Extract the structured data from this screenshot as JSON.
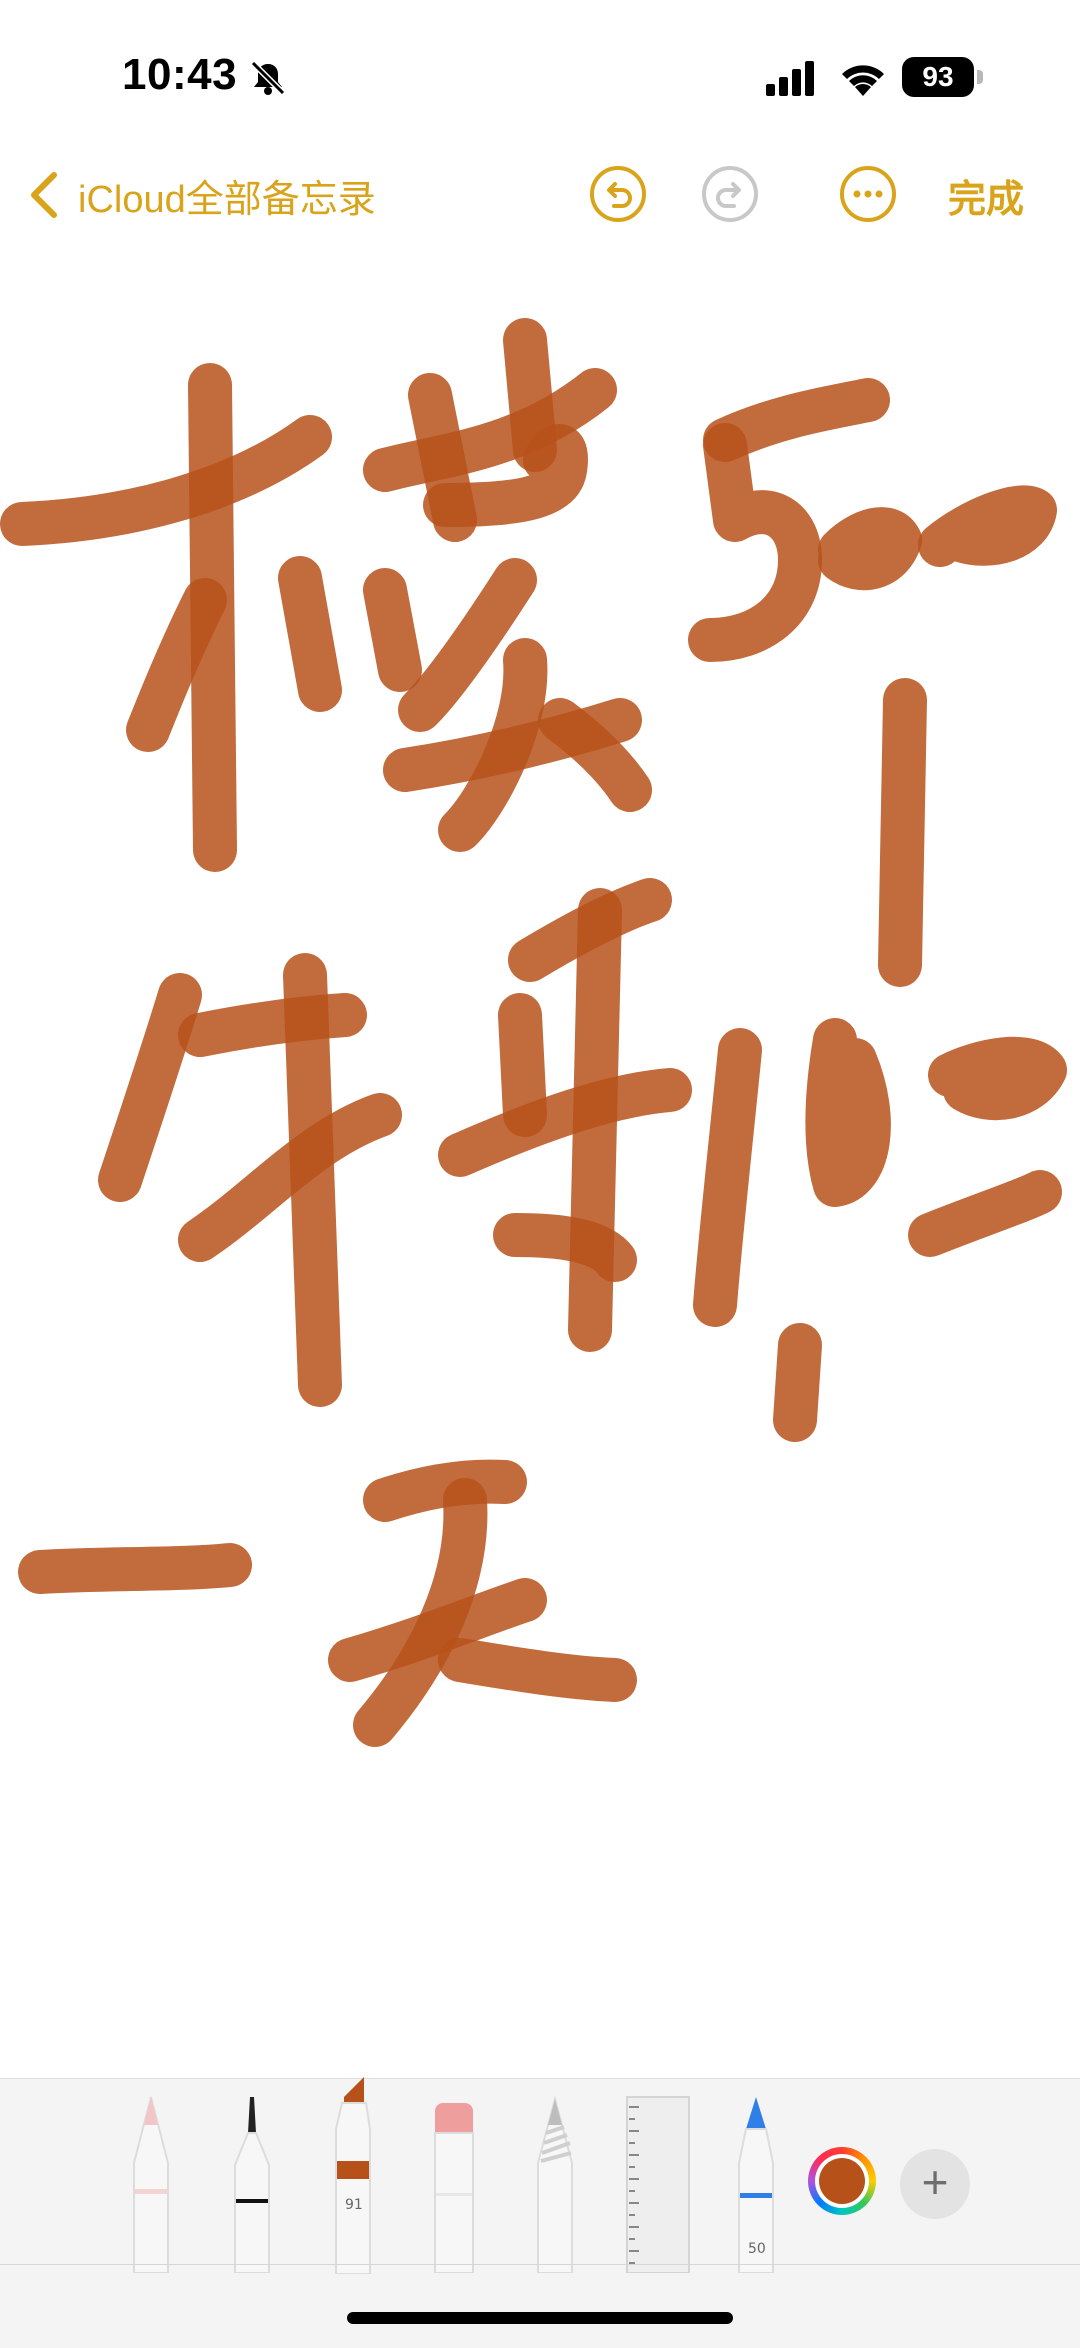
{
  "status_bar": {
    "time": "10:43",
    "battery_level": "93",
    "icons": [
      "bell-slash-icon",
      "cellular-signal-icon",
      "wifi-icon",
      "battery-icon"
    ]
  },
  "nav": {
    "back_label": "iCloud全部备忘录",
    "done_label": "完成",
    "icons": [
      "chevron-left-icon",
      "undo-icon",
      "redo-icon",
      "more-icon"
    ]
  },
  "palette": {
    "marker_width_label": "91",
    "crayon_width_label": "50",
    "selected_color": "#B7511A",
    "accent_color": "#D9A31A",
    "tools": [
      "pen-tool",
      "fineliner-tool",
      "marker-tool",
      "eraser-tool",
      "pencil-tool",
      "ruler-tool",
      "crayon-tool"
    ]
  },
  "canvas": {
    "ink_color": "#B7511A",
    "content": "handwritten drawing"
  }
}
